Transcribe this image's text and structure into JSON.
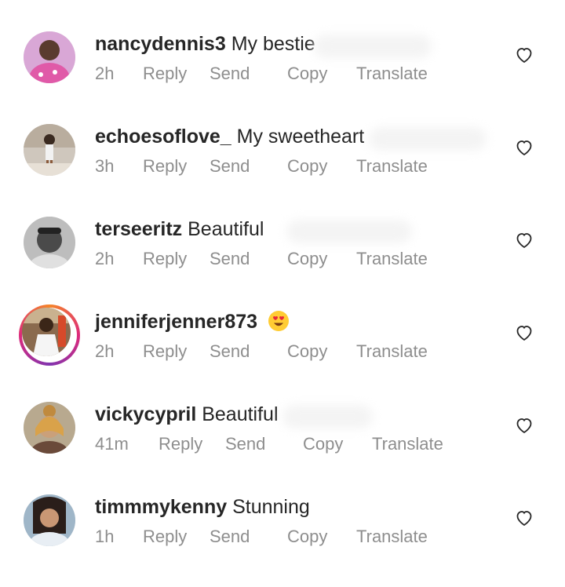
{
  "comments": [
    {
      "username": "nancydennis3",
      "text": "My bestie",
      "time": "2h",
      "reply": "Reply",
      "send": "Send",
      "copy": "Copy",
      "translate": "Translate",
      "avatar_icon": "user-avatar"
    },
    {
      "username": "echoesoflove_",
      "text": "My sweetheart",
      "time": "3h",
      "reply": "Reply",
      "send": "Send",
      "copy": "Copy",
      "translate": "Translate",
      "avatar_icon": "user-avatar"
    },
    {
      "username": "terseeritz",
      "text": "Beautiful",
      "time": "2h",
      "reply": "Reply",
      "send": "Send",
      "copy": "Copy",
      "translate": "Translate",
      "avatar_icon": "user-avatar"
    },
    {
      "username": "jenniferjenner873",
      "text": "",
      "emoji": "heart-eyes-emoji",
      "time": "2h",
      "reply": "Reply",
      "send": "Send",
      "copy": "Copy",
      "translate": "Translate",
      "avatar_icon": "user-avatar-story-ring"
    },
    {
      "username": "vickycypril",
      "text": "Beautiful",
      "time": "41m",
      "reply": "Reply",
      "send": "Send",
      "copy": "Copy",
      "translate": "Translate",
      "avatar_icon": "user-avatar"
    },
    {
      "username": "timmmykenny",
      "text": "Stunning",
      "time": "1h",
      "reply": "Reply",
      "send": "Send",
      "copy": "Copy",
      "translate": "Translate",
      "avatar_icon": "user-avatar"
    }
  ],
  "colors": {
    "text": "#262626",
    "meta": "#8e8e8e",
    "story_ring": [
      "#f58529",
      "#dd2a7b",
      "#8134af"
    ]
  },
  "icons": {
    "like": "heart-outline-icon"
  }
}
